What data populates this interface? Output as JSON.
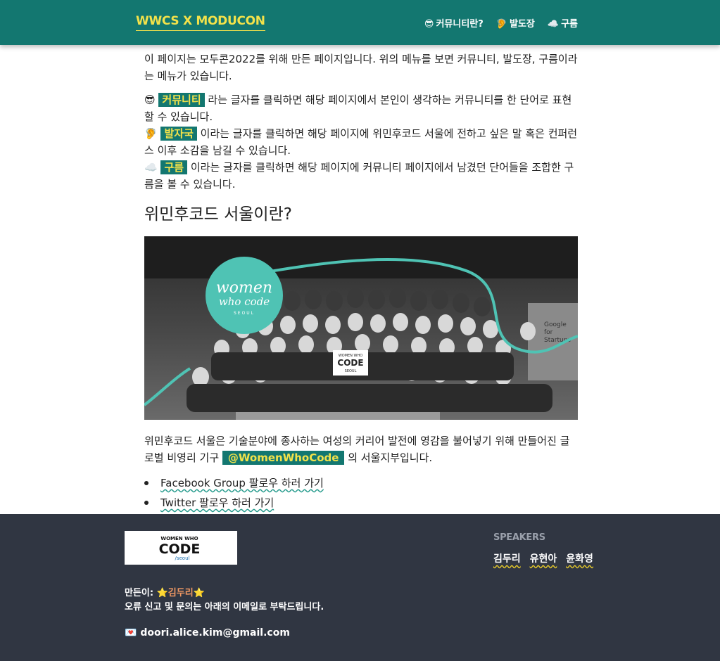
{
  "header": {
    "brand": "WWCS X MODUCON",
    "nav": [
      {
        "emoji": "😎",
        "label": "커뮤니티란?"
      },
      {
        "emoji": "🦻",
        "label": "발도장"
      },
      {
        "emoji": "☁️",
        "label": "구름"
      }
    ]
  },
  "intro": "이 페이지는 모두콘2022를 위해 만든 페이지입니다. 위의 메뉴를 보면 커뮤니티, 발도장, 구름이라는 메뉴가 있습니다.",
  "features": [
    {
      "emoji": "😎",
      "tag": "커뮤니티",
      "text": " 라는 글자를 클릭하면 해당 페이지에서 본인이 생각하는 커뮤니티를 한 단어로 표현할 수 있습니다."
    },
    {
      "emoji": "🦻",
      "tag": "발자국",
      "text": " 이라는 글자를 클릭하면 해당 페이지에 위민후코드 서울에 전하고 싶은 말 혹은 컨퍼런스 이후 소감을 남길 수 있습니다."
    },
    {
      "emoji": "☁️",
      "tag": "구름",
      "text": " 이라는 글자를 클릭하면 해당 페이지에 커뮤니티 페이지에서 남겼던 단어들을 조합한 구름을 볼 수 있습니다."
    }
  ],
  "section": {
    "title": "위민후코드 서울이란?",
    "photo": {
      "badge_line1": "women",
      "badge_line2": "who code",
      "badge_line3": "SEOUL",
      "sign_line1": "WOMEN WHO",
      "sign_line2": "CODE",
      "sign_line3": "SEOUL",
      "google_line1": "Google",
      "google_line2": "for",
      "google_line3": "Startups"
    },
    "desc_before": "위민후코드 서울은 기술분야에 종사하는 여성의 커리어 발전에 영감을 불어넣기 위해 만들어진 글로벌 비영리 기구 ",
    "desc_link": "@WomenWhoCode",
    "desc_after": " 의 서울지부입니다.",
    "links": [
      "Facebook Group 팔로우 하러 가기",
      "Twitter 팔로우 하러 가기"
    ]
  },
  "footer": {
    "logo_line1": "WOMEN WHO",
    "logo_line2": "CODE",
    "logo_line3": "/seoul",
    "speakers_title": "SPEAKERS",
    "speakers": [
      "김두리",
      "유현아",
      "윤화영"
    ],
    "maker_label": "만든이: ",
    "maker_star_left": "⭐",
    "maker_name": "김두리",
    "maker_star_right": "⭐",
    "notice": "오류 신고 및 문의는 아래의 이메일로 부탁드립니다.",
    "email_icon": "💌",
    "email": "doori.alice.kim@gmail.com"
  },
  "colors": {
    "primary": "#137770",
    "accent": "#f3e24a",
    "footer_bg": "#303642",
    "teal_curve": "#4fc3b4"
  }
}
